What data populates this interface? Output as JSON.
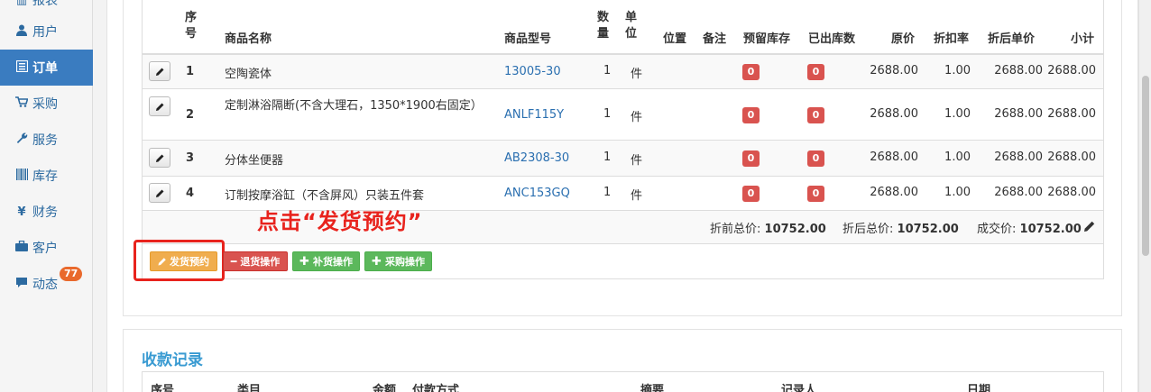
{
  "sidebar": {
    "items": [
      {
        "label": "报表",
        "icon": "chart-icon"
      },
      {
        "label": "用户",
        "icon": "user-icon"
      },
      {
        "label": "订单",
        "icon": "list-icon",
        "active": true
      },
      {
        "label": "采购",
        "icon": "cart-icon"
      },
      {
        "label": "服务",
        "icon": "wrench-icon"
      },
      {
        "label": "库存",
        "icon": "barcode-icon"
      },
      {
        "label": "财务",
        "icon": "yen-icon"
      },
      {
        "label": "客户",
        "icon": "briefcase-icon"
      },
      {
        "label": "动态",
        "icon": "comment-icon",
        "badge": "77"
      }
    ]
  },
  "table": {
    "headers": {
      "seq": "序号",
      "name": "商品名称",
      "model": "商品型号",
      "qty": "数量",
      "unit": "单位",
      "location": "位置",
      "note": "备注",
      "reserved": "预留库存",
      "shipped": "已出库数",
      "price": "原价",
      "discount": "折扣率",
      "discounted_price": "折后单价",
      "subtotal": "小计"
    },
    "rows": [
      {
        "seq": "1",
        "name": "空陶瓷体",
        "model": "13005-30",
        "qty": "1",
        "unit": "件",
        "reserved": "0",
        "shipped": "0",
        "price": "2688.00",
        "discount": "1.00",
        "discounted_price": "2688.00",
        "subtotal": "2688.00"
      },
      {
        "seq": "2",
        "name": "定制淋浴隔断(不含大理石，1350*1900右固定）",
        "model": "ANLF115Y",
        "qty": "1",
        "unit": "件",
        "reserved": "0",
        "shipped": "0",
        "price": "2688.00",
        "discount": "1.00",
        "discounted_price": "2688.00",
        "subtotal": "2688.00"
      },
      {
        "seq": "3",
        "name": "分体坐便器",
        "model": "AB2308-30",
        "qty": "1",
        "unit": "件",
        "reserved": "0",
        "shipped": "0",
        "price": "2688.00",
        "discount": "1.00",
        "discounted_price": "2688.00",
        "subtotal": "2688.00"
      },
      {
        "seq": "4",
        "name": "订制按摩浴缸（不含屏风）只装五件套",
        "model": "ANC153GQ",
        "qty": "1",
        "unit": "件",
        "reserved": "0",
        "shipped": "0",
        "price": "2688.00",
        "discount": "1.00",
        "discounted_price": "2688.00",
        "subtotal": "2688.00"
      }
    ]
  },
  "summary": {
    "pre_label": "折前总价:",
    "pre_value": "10752.00",
    "post_label": "折后总价:",
    "post_value": "10752.00",
    "deal_label": "成交价:",
    "deal_value": "10752.00"
  },
  "actions": {
    "ship": "发货预约",
    "return": "退货操作",
    "restock": "补货操作",
    "purchase": "采购操作"
  },
  "annotation": "点击“发货预约”",
  "payments": {
    "title": "收款记录",
    "headers": {
      "seq": "序号",
      "category": "类目",
      "amount": "金额",
      "method": "付款方式",
      "summary": "摘要",
      "recorder": "记录人",
      "date": "日期"
    }
  },
  "colors": {
    "accent": "#3a7cc0",
    "badge_red": "#d9534f",
    "annotation_red": "#e8231d"
  }
}
